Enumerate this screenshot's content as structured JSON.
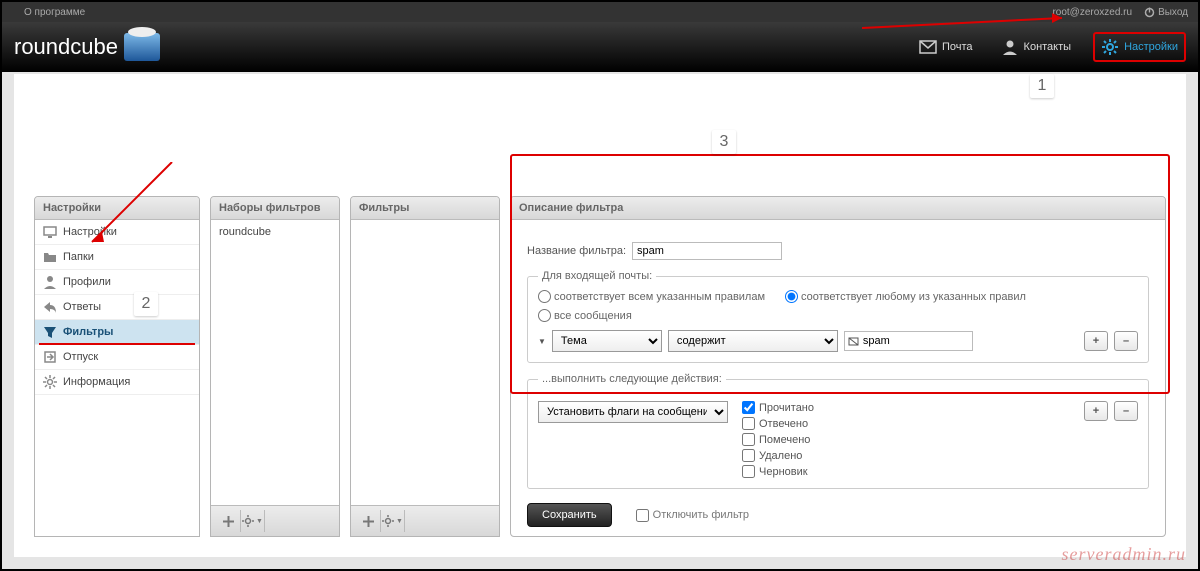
{
  "topbar": {
    "about": "О программе",
    "user": "root@zeroxzed.ru",
    "logout": "Выход"
  },
  "logo": "roundcube",
  "nav": {
    "mail": "Почта",
    "contacts": "Контакты",
    "settings": "Настройки"
  },
  "panels": {
    "settings": "Настройки",
    "filtersets": "Наборы фильтров",
    "filters": "Фильтры",
    "main": "Описание фильтра"
  },
  "settings_items": [
    {
      "label": "Настройки",
      "icon": "monitor"
    },
    {
      "label": "Папки",
      "icon": "folder"
    },
    {
      "label": "Профили",
      "icon": "user"
    },
    {
      "label": "Ответы",
      "icon": "reply"
    },
    {
      "label": "Фильтры",
      "icon": "filter",
      "active": true
    },
    {
      "label": "Отпуск",
      "icon": "export"
    },
    {
      "label": "Информация",
      "icon": "gear"
    }
  ],
  "filtersets_items": [
    "roundcube"
  ],
  "form": {
    "name_label": "Название фильтра:",
    "name_value": "spam",
    "rules_legend": "Для входящей почты:",
    "radio_all": "соответствует всем указанным правилам",
    "radio_any": "соответствует любому из указанных правил",
    "radio_every": "все сообщения",
    "cond_field": "Тема",
    "cond_op": "содержит",
    "cond_value": "spam",
    "actions_legend": "...выполнить следующие действия:",
    "action_select": "Установить флаги на сообщение",
    "flags": [
      "Прочитано",
      "Отвечено",
      "Помечено",
      "Удалено",
      "Черновик"
    ],
    "flags_checked": [
      true,
      false,
      false,
      false,
      false
    ],
    "save": "Сохранить",
    "disable": "Отключить фильтр"
  },
  "annotations": {
    "a1": "1",
    "a2": "2",
    "a3": "3"
  },
  "watermark": "serveradmin.ru"
}
